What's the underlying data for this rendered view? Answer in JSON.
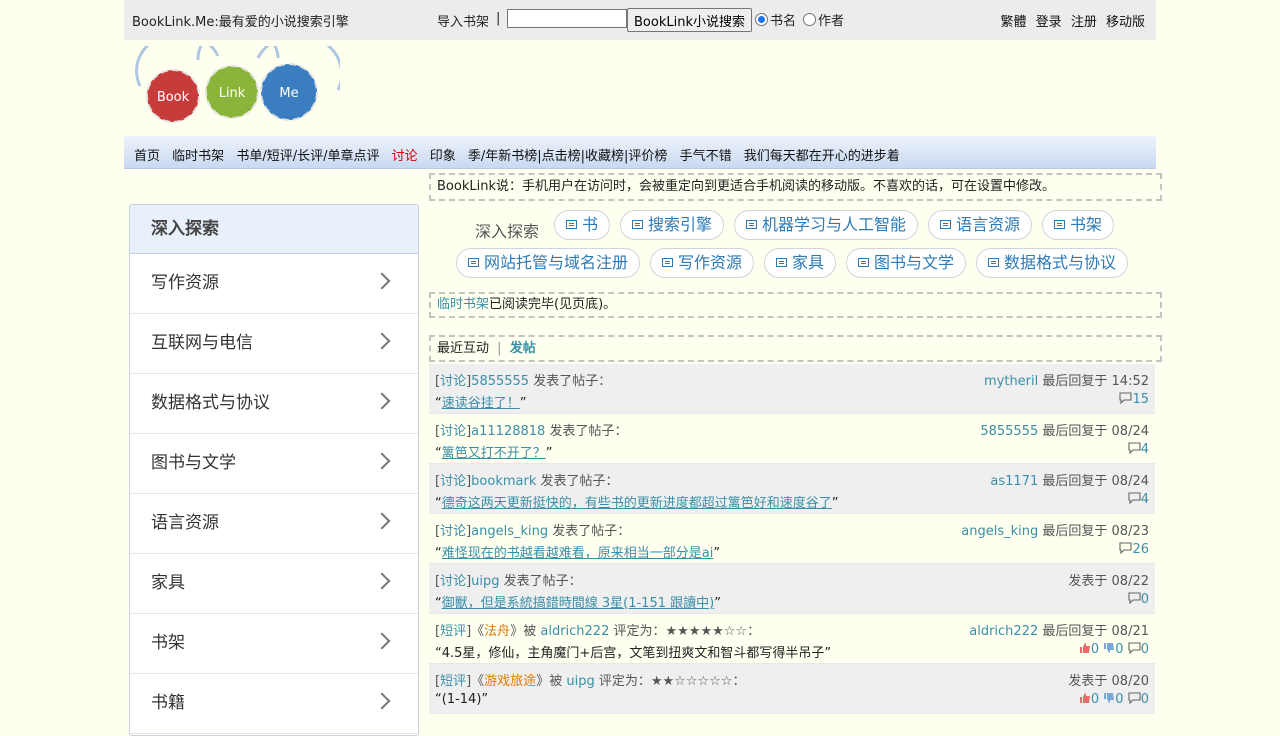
{
  "header": {
    "site_title": "BookLink.Me:最有爱的小说搜索引擎",
    "import_label": "导入书架",
    "separator": "|",
    "search_value": "",
    "search_button": "BookLink小说搜索",
    "radio_title": "书名",
    "radio_author": "作者",
    "links": [
      "繁體",
      "登录",
      "注册",
      "移动版"
    ]
  },
  "logo": {
    "gears": [
      "Book",
      "Link",
      "Me"
    ]
  },
  "nav": {
    "items": [
      "首页",
      "临时书架",
      "书单/短评/长评/单章点评",
      "讨论",
      "印象",
      "季/年新书榜|点击榜|收藏榜|评价榜",
      "手气不错",
      "我们每天都在开心的进步着"
    ],
    "active_index": 3
  },
  "left": {
    "title": "深入探索",
    "items": [
      "写作资源",
      "互联网与电信",
      "数据格式与协议",
      "图书与文学",
      "语言资源",
      "家具",
      "书架",
      "书籍"
    ]
  },
  "notice": "BookLink说：手机用户在访问时，会被重定向到更适合手机阅读的移动版。不喜欢的话，可在设置中修改。",
  "explore": {
    "label": "深入探索",
    "row1": [
      "书",
      "搜索引擎",
      "机器学习与人工智能",
      "语言资源",
      "书架"
    ],
    "row2": [
      "网站托管与域名注册",
      "写作资源",
      "家具",
      "图书与文学",
      "数据格式与协议"
    ]
  },
  "shelf": {
    "link": "临时书架",
    "text": "已阅读完毕(见页底)。"
  },
  "recent": {
    "title": "最近互动",
    "sep": "|",
    "post_link": "发帖"
  },
  "posts": [
    {
      "tag": "讨论",
      "user": "5855555",
      "action": "发表了帖子：",
      "title": "速读谷挂了！",
      "meta_user": "mytheril",
      "meta_text": "最后回复于 14:52",
      "comments": "15"
    },
    {
      "tag": "讨论",
      "user": "a11128818",
      "action": "发表了帖子：",
      "title": "篱笆又打不开了？",
      "meta_user": "5855555",
      "meta_text": "最后回复于 08/24",
      "comments": "4"
    },
    {
      "tag": "讨论",
      "user": "bookmark",
      "action": "发表了帖子：",
      "title": "德奇这两天更新挺快的，有些书的更新进度都超过篱笆好和速度谷了",
      "meta_user": "as1171",
      "meta_text": "最后回复于 08/24",
      "comments": "4"
    },
    {
      "tag": "讨论",
      "user": "angels_king",
      "action": "发表了帖子：",
      "title": "难怪现在的书越看越难看，原来相当一部分是ai",
      "meta_user": "angels_king",
      "meta_text": "最后回复于 08/23",
      "comments": "26"
    },
    {
      "tag": "讨论",
      "user": "uipg",
      "action": "发表了帖子：",
      "title": "御獸，但是系統搞錯時間線 3星(1-151 跟讀中)",
      "meta_user": "",
      "meta_text": "发表于 08/22",
      "comments": "0"
    }
  ],
  "reviews": [
    {
      "tag": "短评",
      "book": "法舟",
      "by": "被",
      "user": "aldrich222",
      "rated": "评定为：★★★★★☆☆：",
      "text": "4.5星，修仙，主角魔门+后宫，文笔到扭爽文和智斗都写得半吊子",
      "meta_user": "aldrich222",
      "meta_text": "最后回复于 08/21",
      "up": "0",
      "down": "0",
      "comments": "0"
    },
    {
      "tag": "短评",
      "book": "游戏旅途",
      "by": "被",
      "user": "uipg",
      "rated": "评定为：★★☆☆☆☆☆：",
      "text": "(1-14)",
      "meta_user": "",
      "meta_text": "发表于 08/20",
      "up": "0",
      "down": "0",
      "comments": "0"
    }
  ],
  "colors": {
    "accent": "#3a8fa8",
    "active_nav": "#d40000",
    "book_title": "#e07b00"
  }
}
